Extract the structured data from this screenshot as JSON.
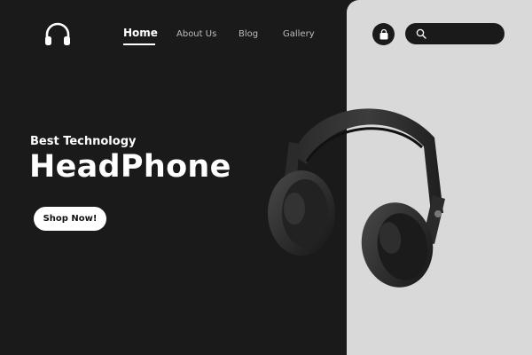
{
  "nav": {
    "items": [
      {
        "label": "Home"
      },
      {
        "label": "About Us"
      },
      {
        "label": "Blog"
      },
      {
        "label": "Gallery"
      }
    ]
  },
  "header": {
    "logo_icon": "headphones-icon",
    "cart_icon": "shopping-bag-icon",
    "search_icon": "search-icon",
    "search_placeholder": ""
  },
  "hero": {
    "subtitle": "Best Technology",
    "title": "HeadPhone",
    "cta_label": "Shop Now!"
  },
  "colors": {
    "dark": "#1a1a1a",
    "light": "#d9d9d9",
    "text": "#ffffff"
  }
}
